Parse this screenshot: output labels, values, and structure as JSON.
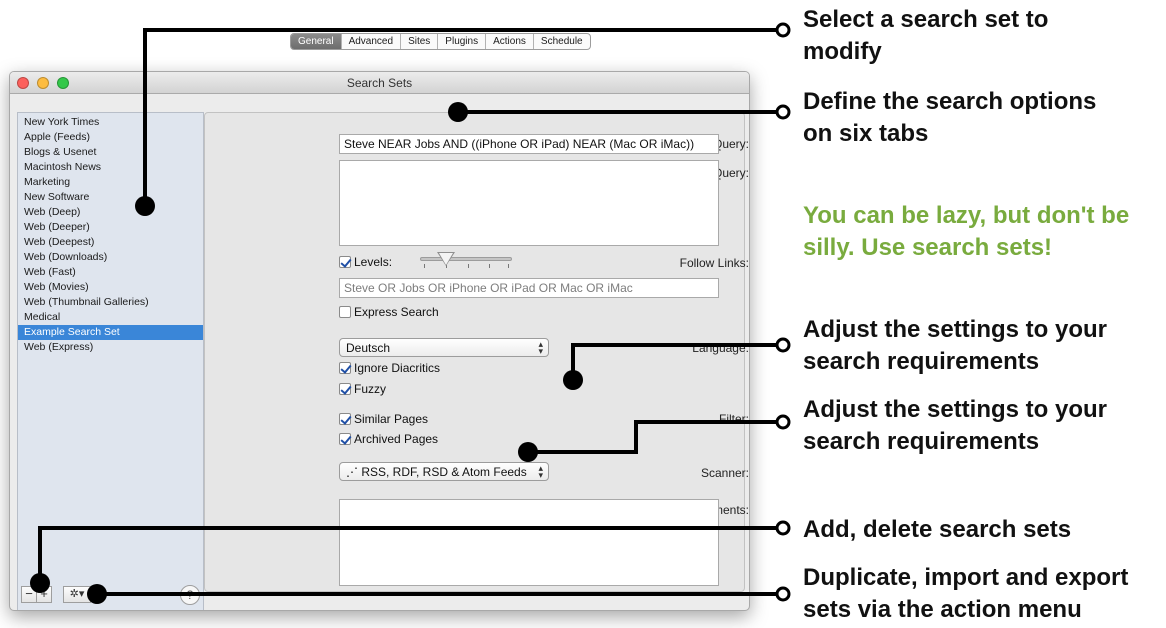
{
  "window": {
    "title": "Search Sets"
  },
  "sidebar": {
    "items": [
      "New York Times",
      "Apple (Feeds)",
      "Blogs & Usenet",
      "Macintosh News",
      "Marketing",
      "New Software",
      "Web (Deep)",
      "Web (Deeper)",
      "Web (Deepest)",
      "Web (Downloads)",
      "Web (Fast)",
      "Web (Movies)",
      "Web (Thumbnail Galleries)",
      "Medical",
      "Example Search Set",
      "Web (Express)"
    ],
    "selected_item": "Example Search Set",
    "buttons": {
      "remove": "−",
      "add": "+",
      "action": "✲▾",
      "help": "?"
    }
  },
  "tabs": [
    "General",
    "Advanced",
    "Sites",
    "Plugins",
    "Actions",
    "Schedule"
  ],
  "active_tab": "General",
  "form": {
    "default_query_label": "Default Query:",
    "default_query_value": "Steve NEAR Jobs AND ((iPhone OR iPad) NEAR (Mac OR iMac))",
    "secondary_query_label": "Secondary Query:",
    "secondary_query_value": "",
    "follow_links_label": "Follow Links:",
    "levels_label": "Levels:",
    "levels_checked": true,
    "levels_query_placeholder": "Steve OR Jobs OR iPhone OR iPad OR Mac OR iMac",
    "express_search_label": "Express Search",
    "express_search_checked": false,
    "language_label": "Language:",
    "language_value": "Deutsch",
    "ignore_diacritics_label": "Ignore Diacritics",
    "ignore_diacritics_checked": true,
    "fuzzy_label": "Fuzzy",
    "fuzzy_checked": true,
    "filter_label": "Filter:",
    "similar_pages_label": "Similar Pages",
    "similar_pages_checked": true,
    "archived_pages_label": "Archived Pages",
    "archived_pages_checked": true,
    "scanner_label": "Scanner:",
    "scanner_value": "RSS, RDF, RSD & Atom Feeds",
    "comments_label": "Comments:",
    "comments_value": ""
  },
  "annotations": {
    "select_set": [
      "Select a search set to",
      "modify"
    ],
    "define_options": [
      "Define the search options",
      "on six tabs"
    ],
    "tip": [
      "You can be lazy, but don't be",
      "silly. Use search sets!"
    ],
    "adjust_1": [
      "Adjust the settings to your",
      "search requirements"
    ],
    "adjust_2": [
      "Adjust the settings to your",
      "search requirements"
    ],
    "add_delete": [
      "Add, delete search sets"
    ],
    "duplicate": [
      "Duplicate, import and export",
      "sets via the action menu"
    ]
  },
  "colors": {
    "selection": "#3a86d8",
    "tip_green": "#79ab3e"
  }
}
